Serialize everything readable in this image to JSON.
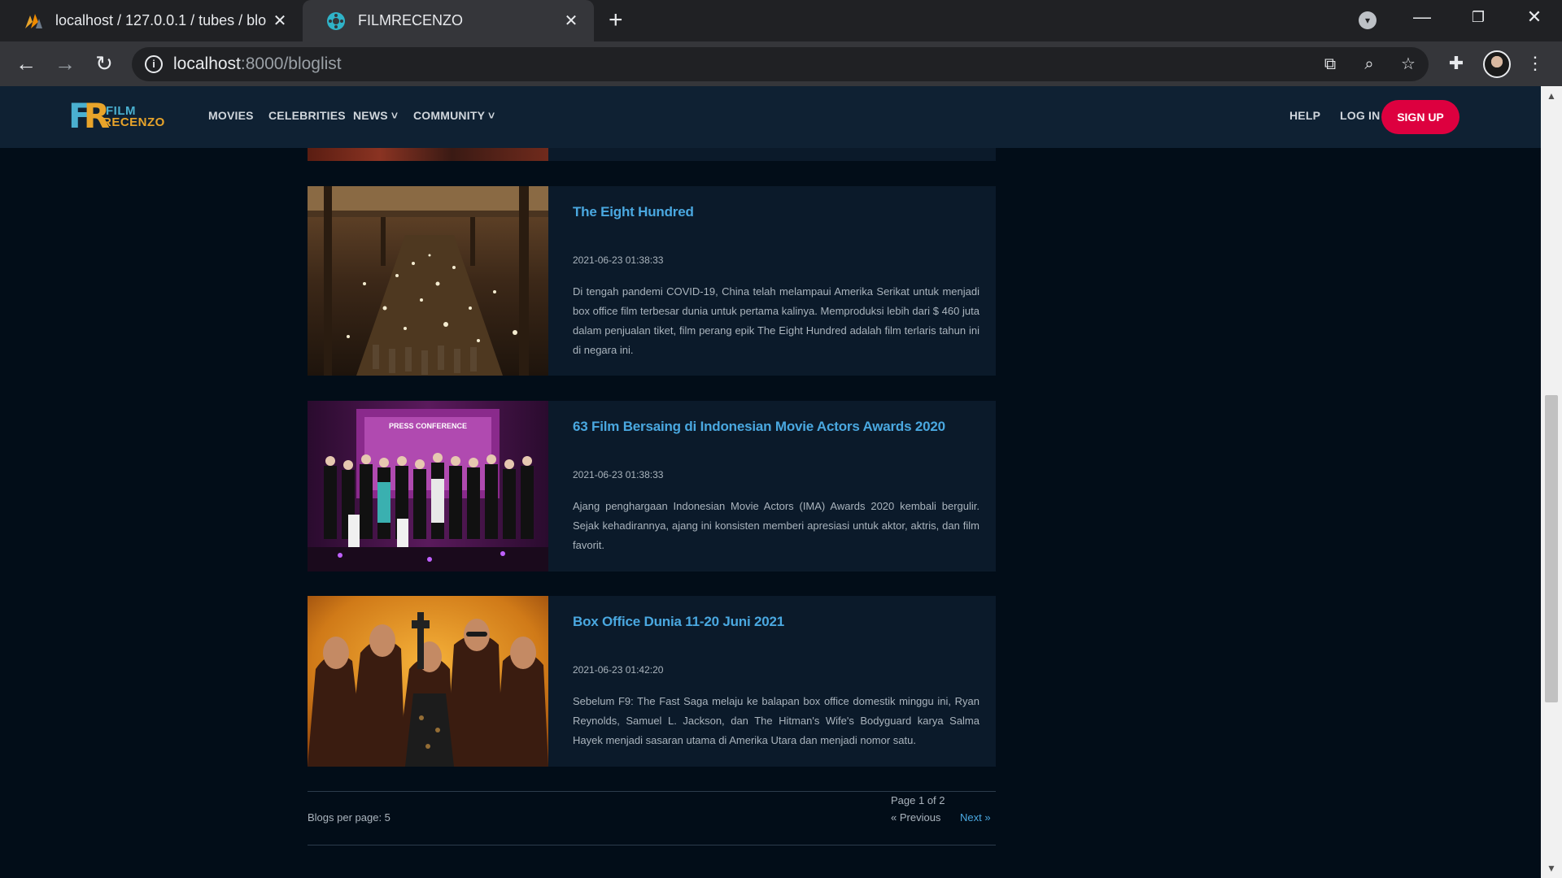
{
  "browser": {
    "tabs": [
      {
        "title": "localhost / 127.0.0.1 / tubes / blo",
        "close": "✕"
      },
      {
        "title": "FILMRECENZO",
        "close": "✕"
      }
    ],
    "new_tab": "+",
    "url_host": "localhost",
    "url_path": ":8000/bloglist"
  },
  "site": {
    "logo_line1": "FILM",
    "logo_line2": "RECENZO",
    "logo_mark_f": "F",
    "logo_mark_r": "R",
    "nav": {
      "movies": "MOVIES",
      "celebrities": "CELEBRITIES",
      "news": "NEWS",
      "community": "COMMUNITY",
      "help": "HELP",
      "login": "LOG IN",
      "signup": "SIGN UP"
    }
  },
  "posts": [
    {
      "title": "The Eight Hundred",
      "date": "2021-06-23 01:38:33",
      "excerpt": "Di tengah pandemi COVID-19, China telah melampaui Amerika Serikat untuk menjadi box office film terbesar dunia untuk pertama kalinya. Memproduksi lebih dari $ 460 juta dalam penjualan tiket, film perang epik The Eight Hundred adalah film terlaris tahun ini di negara ini."
    },
    {
      "title": "63 Film Bersaing di Indonesian Movie Actors Awards 2020",
      "date": "2021-06-23 01:38:33",
      "excerpt": "Ajang penghargaan Indonesian Movie Actors (IMA) Awards 2020 kembali bergulir. Sejak kehadirannya, ajang ini konsisten memberi apresiasi untuk aktor, aktris, dan film favorit.",
      "image_text": "PRESS CONFERENCE"
    },
    {
      "title": "Box Office Dunia 11-20 Juni 2021",
      "date": "2021-06-23 01:42:20",
      "excerpt": "Sebelum F9: The Fast Saga melaju ke balapan box office domestik minggu ini, Ryan Reynolds, Samuel L. Jackson, dan The Hitman's Wife's Bodyguard karya Salma Hayek menjadi sasaran utama di Amerika Utara dan menjadi nomor satu."
    }
  ],
  "pagination": {
    "per_page": "Blogs per page: 5",
    "page_of": "Page 1 of 2",
    "previous": "« Previous",
    "next": "Next »"
  },
  "colors": {
    "accent": "#dd003f",
    "link": "#4aa8e0",
    "header_bg": "#0f2133",
    "page_bg": "#020d18"
  }
}
